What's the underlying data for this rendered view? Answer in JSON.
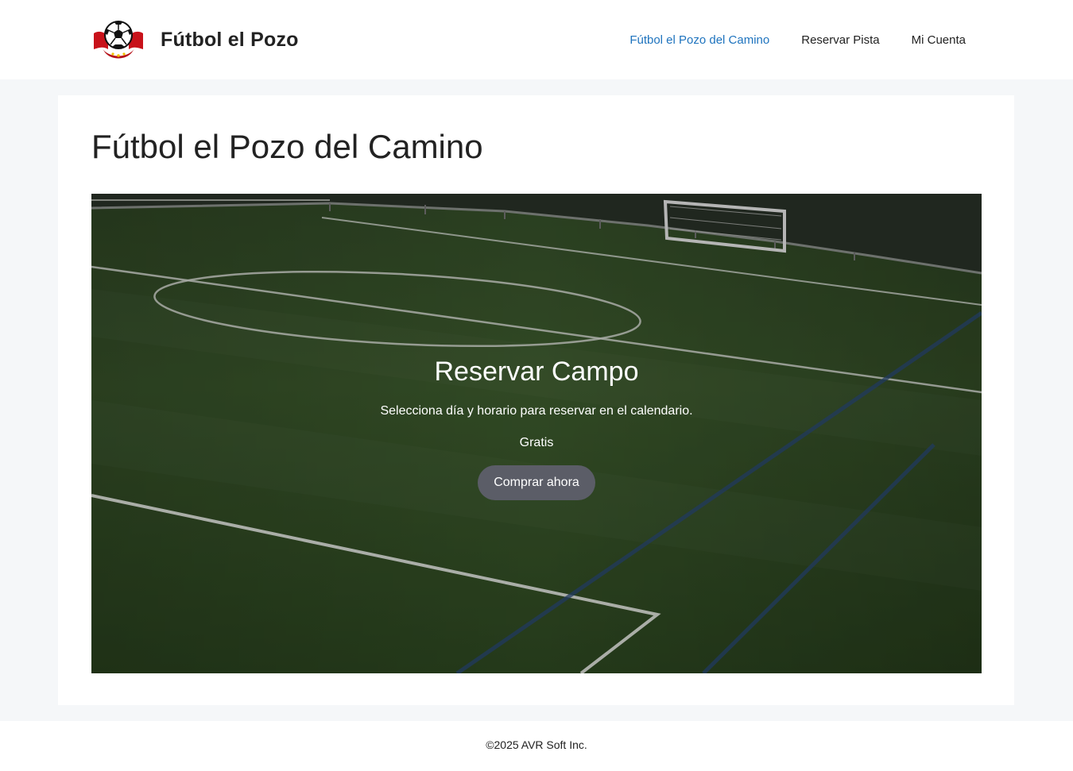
{
  "header": {
    "site_title": "Fútbol el Pozo",
    "logo_icon": "soccer-ball-crest-icon",
    "nav": [
      {
        "label": "Fútbol el Pozo del Camino",
        "active": true
      },
      {
        "label": "Reservar Pista",
        "active": false
      },
      {
        "label": "Mi Cuenta",
        "active": false
      }
    ]
  },
  "main": {
    "page_title": "Fútbol el Pozo del Camino",
    "hero": {
      "title": "Reservar Campo",
      "description": "Selecciona día y horario para reservar en el calendario.",
      "price": "Gratis",
      "button_label": "Comprar ahora"
    }
  },
  "footer": {
    "copyright": "©2025 AVR Soft Inc."
  },
  "colors": {
    "accent": "#1e73be",
    "text": "#222222",
    "page_bg": "#f5f7f9",
    "button_bg": "#5f5f6e"
  }
}
